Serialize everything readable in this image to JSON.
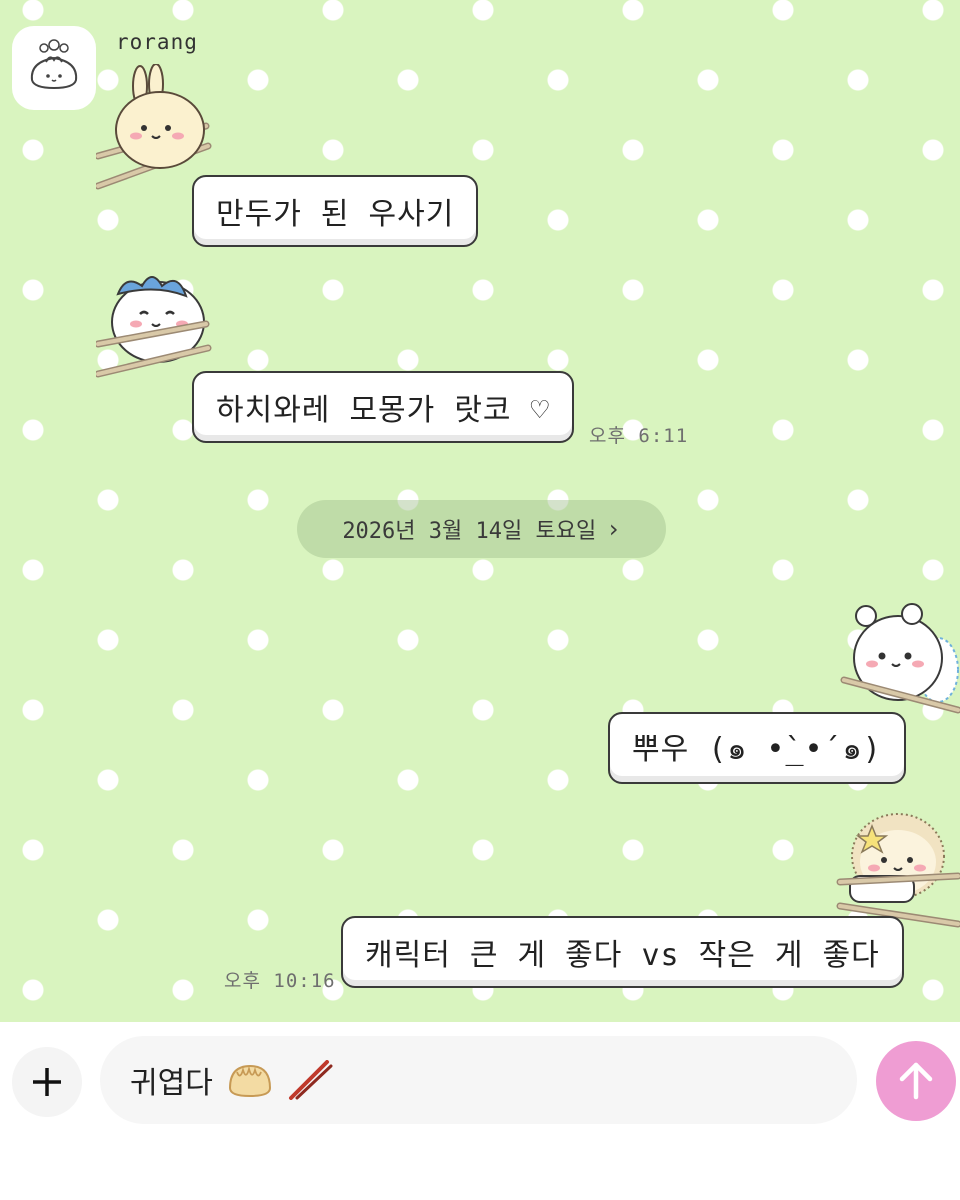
{
  "chat": {
    "sender_name": "rorang",
    "messages": [
      {
        "side": "received",
        "text": "만두가 된 우사기"
      },
      {
        "side": "received",
        "text": "하치와레 모몽가 랏코 ♡",
        "time": "오후 6:11"
      },
      {
        "side": "sent",
        "text": "뿌우 (๑ •̀_•́ ๑)"
      },
      {
        "side": "sent",
        "text": "캐릭터 큰 게 좋다 vs 작은 게 좋다",
        "time": "오후 10:16"
      }
    ],
    "date_divider": "2026년 3월 14일 토요일",
    "date_divider_icon": "chevron-right-icon"
  },
  "composer": {
    "input_value": "귀엽다",
    "input_icons": [
      "dumpling-icon",
      "chopsticks-icon"
    ],
    "add_icon": "plus-icon",
    "send_icon": "arrow-up-icon"
  },
  "colors": {
    "chat_background": "#d9f4bf",
    "polka_dot": "#ffffff",
    "bubble_border": "#3a3a3a",
    "send_button": "#ef9dd3"
  }
}
